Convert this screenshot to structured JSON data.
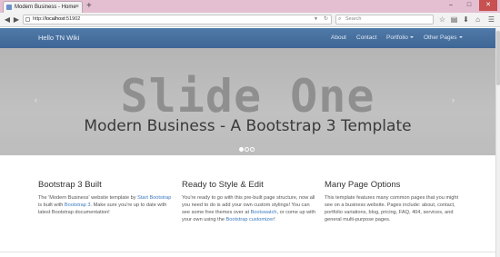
{
  "browser": {
    "tab_title": "Modern Business - Home",
    "tab_close": "×",
    "new_tab": "+",
    "url_prefix": "http://",
    "url_host": "localhost",
    "url_port": ":51902",
    "search_placeholder": "Search",
    "window_controls": [
      "–",
      "□",
      "✕"
    ]
  },
  "site": {
    "brand": "Hello TN Wiki",
    "nav": [
      {
        "label": "About"
      },
      {
        "label": "Contact"
      },
      {
        "label": "Portfolio"
      },
      {
        "label": "Other Pages"
      }
    ]
  },
  "carousel": {
    "heading": "Slide One",
    "caption": "Modern Business - A Bootstrap 3 Template",
    "prev": "‹",
    "next": "›",
    "indicators": [
      true,
      false,
      false
    ]
  },
  "columns": [
    {
      "title": "Bootstrap 3 Built",
      "text_1": "The 'Modern Business' website template by ",
      "link_1": "Start Bootstrap",
      "text_2": " is built with ",
      "link_2": "Bootstrap 3",
      "text_3": ". Make sure you're up to date with latest Bootstrap documentation!"
    },
    {
      "title": "Ready to Style & Edit",
      "text_1": "You're ready to go with this pre-built page structure, now all you need to do is add your own custom stylings! You can see some free themes over at ",
      "link_1": "Bootswatch",
      "text_2": ", or come up with your own using the ",
      "link_2": "Bootstrap customizer",
      "text_3": "!"
    },
    {
      "title": "Many Page Options",
      "text_1": "This template features many common pages that you might see on a business website. Pages include: about, contact, portfolio variations, blog, pricing, FAQ, 404, services, and general multi-purpose pages."
    }
  ]
}
